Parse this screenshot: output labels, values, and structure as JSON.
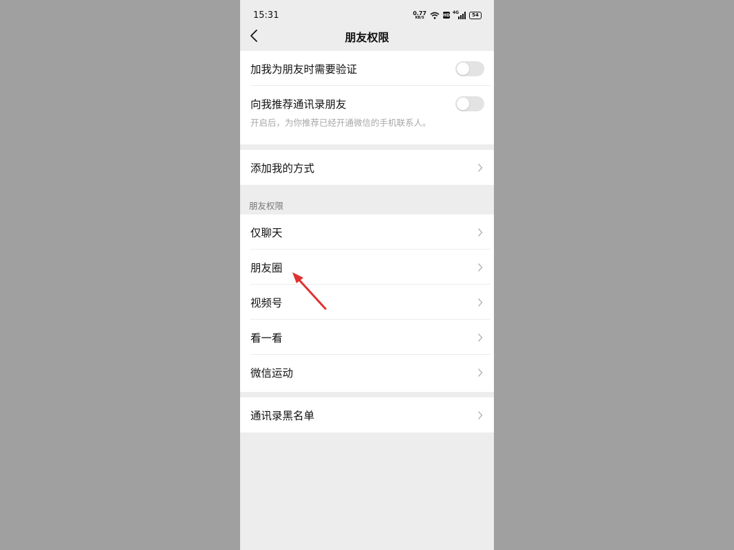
{
  "status_bar": {
    "time": "15:31",
    "net_speed": "0.77",
    "net_unit": "KB/S",
    "hd": "HD",
    "signal_type": "4G",
    "battery": "54"
  },
  "nav": {
    "title": "朋友权限"
  },
  "verify_group": {
    "verify_label": "加我为朋友时需要验证",
    "recommend_label": "向我推荐通讯录朋友",
    "recommend_hint": "开启后，为你推荐已经开通微信的手机联系人。"
  },
  "add_methods": {
    "label": "添加我的方式"
  },
  "permissions": {
    "section_title": "朋友权限",
    "items": [
      {
        "label": "仅聊天"
      },
      {
        "label": "朋友圈"
      },
      {
        "label": "视频号"
      },
      {
        "label": "看一看"
      },
      {
        "label": "微信运动"
      }
    ]
  },
  "blacklist": {
    "label": "通讯录黑名单"
  },
  "colors": {
    "annotation_arrow": "#e03030",
    "toggle_off": "#e3e3e3"
  }
}
